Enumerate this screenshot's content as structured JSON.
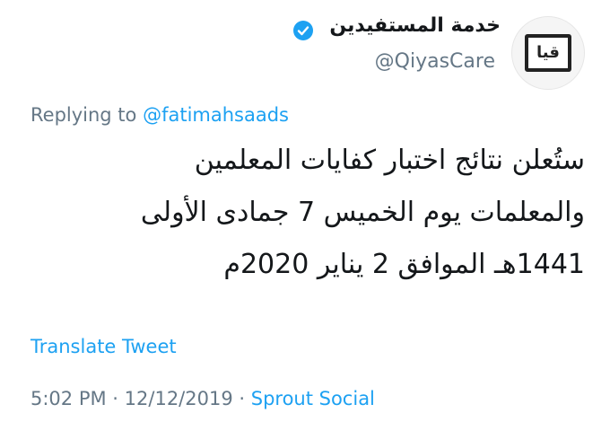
{
  "tweet": {
    "author": {
      "display_name": "خدمة المستفيدين",
      "handle": "@QiyasCare",
      "verified": true,
      "avatar_icon": "qiyas-logo"
    },
    "replying_label": "Replying to ",
    "replying_to": "@fatimahsaads",
    "body_lines": [
      "ستُعلن نتائج اختبار كفايات المعلمين",
      "والمعلمات يوم الخميس 7 جمادى الأولى",
      "1441هـ الموافق 2 يناير 2020م"
    ],
    "translate_label": "Translate Tweet",
    "time": "5:02 PM",
    "separator": " · ",
    "date": "12/12/2019",
    "source": "Sprout Social"
  },
  "colors": {
    "link": "#1da1f2",
    "muted": "#657786",
    "text": "#14171a"
  }
}
